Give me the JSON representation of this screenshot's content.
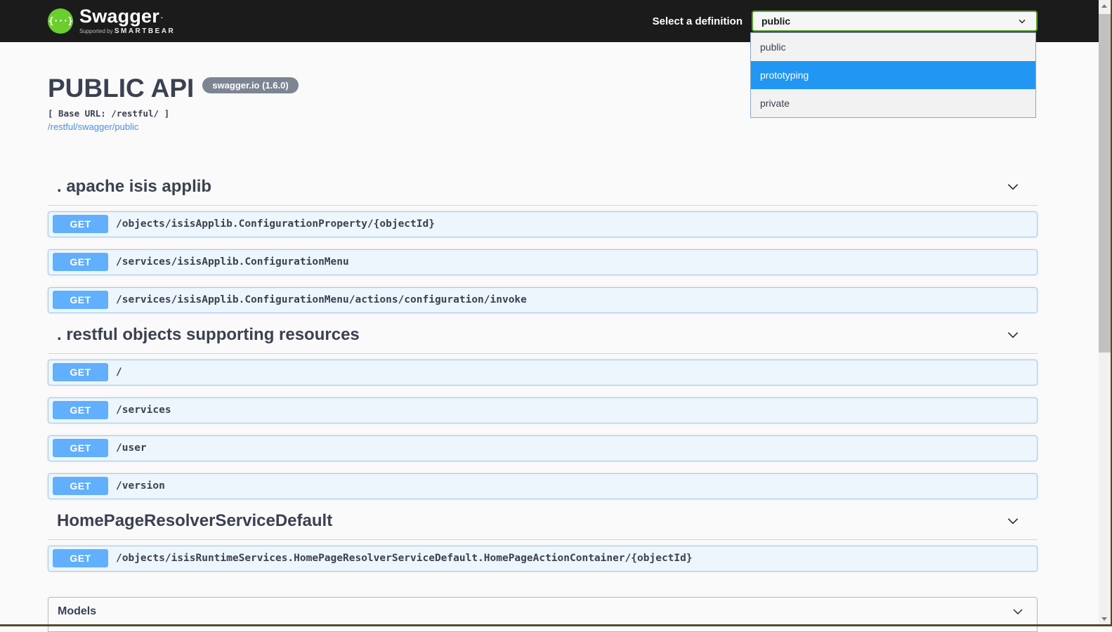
{
  "header": {
    "logo": {
      "brand": "Swagger",
      "trademark": ".",
      "braces_glyph": "{···}",
      "supported_by": "Supported by",
      "smartbear": "SMARTBEAR"
    },
    "definition_label": "Select a definition",
    "selected_definition": "public"
  },
  "definition_dropdown": {
    "options": [
      {
        "label": "public",
        "highlighted": false
      },
      {
        "label": "prototyping",
        "highlighted": true
      },
      {
        "label": "private",
        "highlighted": false
      }
    ]
  },
  "api_info": {
    "title": "PUBLIC API",
    "version_badge": "swagger.io (1.6.0)",
    "base_url": "[ Base URL: /restful/ ]",
    "spec_link": "/restful/swagger/public"
  },
  "sections": [
    {
      "title": ". apache isis applib",
      "operations": [
        {
          "method": "GET",
          "path": "/objects/isisApplib.ConfigurationProperty/{objectId}"
        },
        {
          "method": "GET",
          "path": "/services/isisApplib.ConfigurationMenu"
        },
        {
          "method": "GET",
          "path": "/services/isisApplib.ConfigurationMenu/actions/configuration/invoke"
        }
      ]
    },
    {
      "title": ". restful objects supporting resources",
      "operations": [
        {
          "method": "GET",
          "path": "/"
        },
        {
          "method": "GET",
          "path": "/services"
        },
        {
          "method": "GET",
          "path": "/user"
        },
        {
          "method": "GET",
          "path": "/version"
        }
      ]
    },
    {
      "title": "HomePageResolverServiceDefault",
      "operations": [
        {
          "method": "GET",
          "path": "/objects/isisRuntimeServices.HomePageResolverServiceDefault.HomePageActionContainer/{objectId}"
        }
      ]
    }
  ],
  "models": {
    "title": "Models"
  },
  "colors": {
    "topbar_bg": "#1b1b1b",
    "logo_green": "#6ace2c",
    "select_border_green": "#5c9e31",
    "dropdown_highlight_blue": "#2196f3",
    "get_badge_blue": "#61affe",
    "opblock_bg": "#edf5fd",
    "opblock_border": "#9ccbf8",
    "heading_text": "#3b4151",
    "version_badge_bg": "#7d8492",
    "link_blue": "#4990e2",
    "page_bg": "#fafafa",
    "scrollbar_thumb": "#c1c1c1",
    "window_edge": "#524a2c"
  }
}
